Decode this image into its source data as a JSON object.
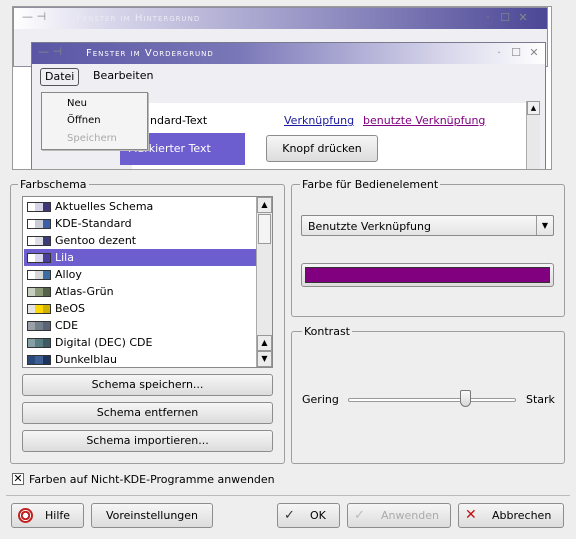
{
  "preview": {
    "bg_window_title": "Fenster im Hintergrund",
    "fg_window_title": "Fenster im Vordergrund",
    "menu_datei": "Datei",
    "menu_bearbeiten": "Bearbeiten",
    "popup_items": [
      "Neu",
      "Öffnen",
      "Speichern"
    ],
    "standard_text": "Standard-Text",
    "selected_text": "Markierter Text",
    "link": "Verknüpfung",
    "visited_link": "benutzte Verknüpfung",
    "push_button": "Knopf drücken"
  },
  "farbschema": {
    "legend": "Farbschema",
    "items": [
      {
        "label": "Aktuelles Schema",
        "colors": [
          "#ffffff",
          "#d6d4e6",
          "#3b3778"
        ]
      },
      {
        "label": "KDE-Standard",
        "colors": [
          "#ffffff",
          "#c9ced6",
          "#3b5ea7"
        ]
      },
      {
        "label": "Gentoo dezent",
        "colors": [
          "#ffffff",
          "#e0dfe8",
          "#3c3a77"
        ]
      },
      {
        "label": "Lila",
        "colors": [
          "#ffffff",
          "#d8d5ee",
          "#4a3e9c"
        ]
      },
      {
        "label": "Alloy",
        "colors": [
          "#ffffff",
          "#d8d8d8",
          "#3a6ea5"
        ]
      },
      {
        "label": "Atlas-Grün",
        "colors": [
          "#c7cfc0",
          "#8c9a7a",
          "#55634a"
        ]
      },
      {
        "label": "BeOS",
        "colors": [
          "#e4e4e4",
          "#ffd700",
          "#d0b000"
        ]
      },
      {
        "label": "CDE",
        "colors": [
          "#9aa0a8",
          "#73808c",
          "#596574"
        ]
      },
      {
        "label": "Digital (DEC) CDE",
        "colors": [
          "#84a0a4",
          "#5b7d84",
          "#3e5c63"
        ]
      },
      {
        "label": "Dunkelblau",
        "colors": [
          "#2a4a7a",
          "#3d5f92",
          "#1a3560"
        ]
      }
    ],
    "selected_index": 3,
    "save_button": "Schema speichern...",
    "remove_button": "Schema entfernen",
    "import_button": "Schema importieren..."
  },
  "farbe": {
    "legend": "Farbe für Bedienelement",
    "combo_value": "Benutzte Verknüpfung",
    "color_value": "#800080"
  },
  "kontrast": {
    "legend": "Kontrast",
    "low_label": "Gering",
    "high_label": "Stark",
    "value_fraction": 0.7
  },
  "apply_checkbox": {
    "label": "Farben auf Nicht-KDE-Programme anwenden",
    "checked": true
  },
  "buttons": {
    "help": "Hilfe",
    "defaults": "Voreinstellungen",
    "ok": "OK",
    "apply": "Anwenden",
    "cancel": "Abbrechen"
  }
}
